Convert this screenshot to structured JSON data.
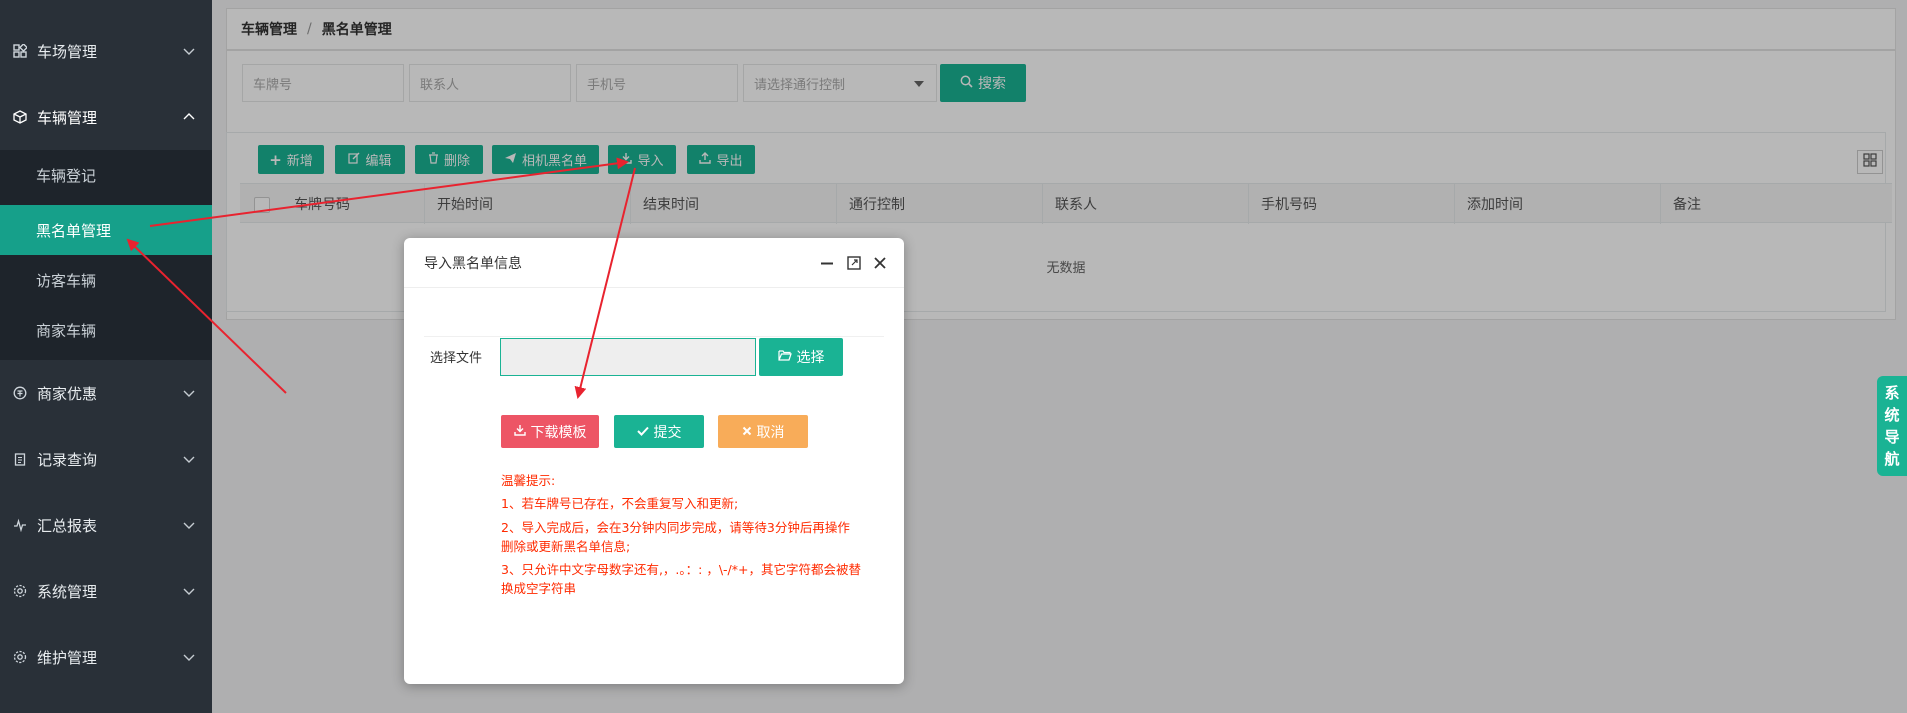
{
  "sidebar": {
    "menus": [
      {
        "label": "车场管理",
        "icon": "grid-icon"
      },
      {
        "label": "车辆管理",
        "icon": "cube-icon"
      },
      {
        "label": "商家优惠",
        "icon": "coupon-icon"
      },
      {
        "label": "记录查询",
        "icon": "clipboard-icon"
      },
      {
        "label": "汇总报表",
        "icon": "pulse-icon"
      },
      {
        "label": "系统管理",
        "icon": "gear-icon"
      },
      {
        "label": "维护管理",
        "icon": "gear-icon"
      }
    ],
    "submenu": [
      "车辆登记",
      "黑名单管理",
      "访客车辆",
      "商家车辆"
    ]
  },
  "breadcrumb": {
    "parent": "车辆管理",
    "separator": "/",
    "current": "黑名单管理"
  },
  "search": {
    "plate_placeholder": "车牌号",
    "contact_placeholder": "联系人",
    "phone_placeholder": "手机号",
    "control_placeholder": "请选择通行控制",
    "search_label": "搜索"
  },
  "toolbar": {
    "add": "新增",
    "edit": "编辑",
    "delete": "删除",
    "camera_blacklist": "相机黑名单",
    "import": "导入",
    "export": "导出"
  },
  "table": {
    "columns": [
      "车牌号码",
      "开始时间",
      "结束时间",
      "通行控制",
      "联系人",
      "手机号码",
      "添加时间",
      "备注"
    ],
    "empty_text": "无数据"
  },
  "side_nav": [
    "系",
    "统",
    "导",
    "航"
  ],
  "modal": {
    "title": "导入黑名单信息",
    "file_label": "选择文件",
    "choose_label": "选择",
    "download_label": "下载模板",
    "submit_label": "提交",
    "cancel_label": "取消",
    "tips_title": "温馨提示:",
    "tips": [
      "1、若车牌号已存在，不会重复写入和更新;",
      "2、导入完成后，会在3分钟内同步完成，请等待3分钟后再操作删除或更新黑名单信息;",
      "3、只允许中文字母数字还有,，.。：: ，\\-/*+，其它字符都会被替换成空字符串"
    ]
  },
  "colors": {
    "sidebar_bg": "#293038",
    "accent": "#1ab394",
    "danger": "#ed5565",
    "warning": "#f8ac59",
    "annotation": "#e8232f"
  }
}
